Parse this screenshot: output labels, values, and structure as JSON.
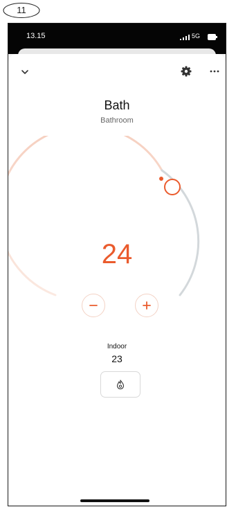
{
  "callout": {
    "label": "11"
  },
  "status_bar": {
    "time": "13.15",
    "network": "5G"
  },
  "header": {
    "title": "Bath",
    "subtitle": "Bathroom",
    "icons": [
      "chevron-down-icon",
      "gear-icon",
      "more-icon"
    ]
  },
  "thermostat": {
    "setpoint": "24",
    "minus_label": "−",
    "plus_label": "+"
  },
  "indoor": {
    "label": "Indoor",
    "value": "23"
  },
  "mode": {
    "icon": "flame-icon"
  },
  "colors": {
    "accent": "#ea5b2d",
    "arc_warm": "#f8d9cc",
    "arc_neutral": "#d3d8db"
  }
}
